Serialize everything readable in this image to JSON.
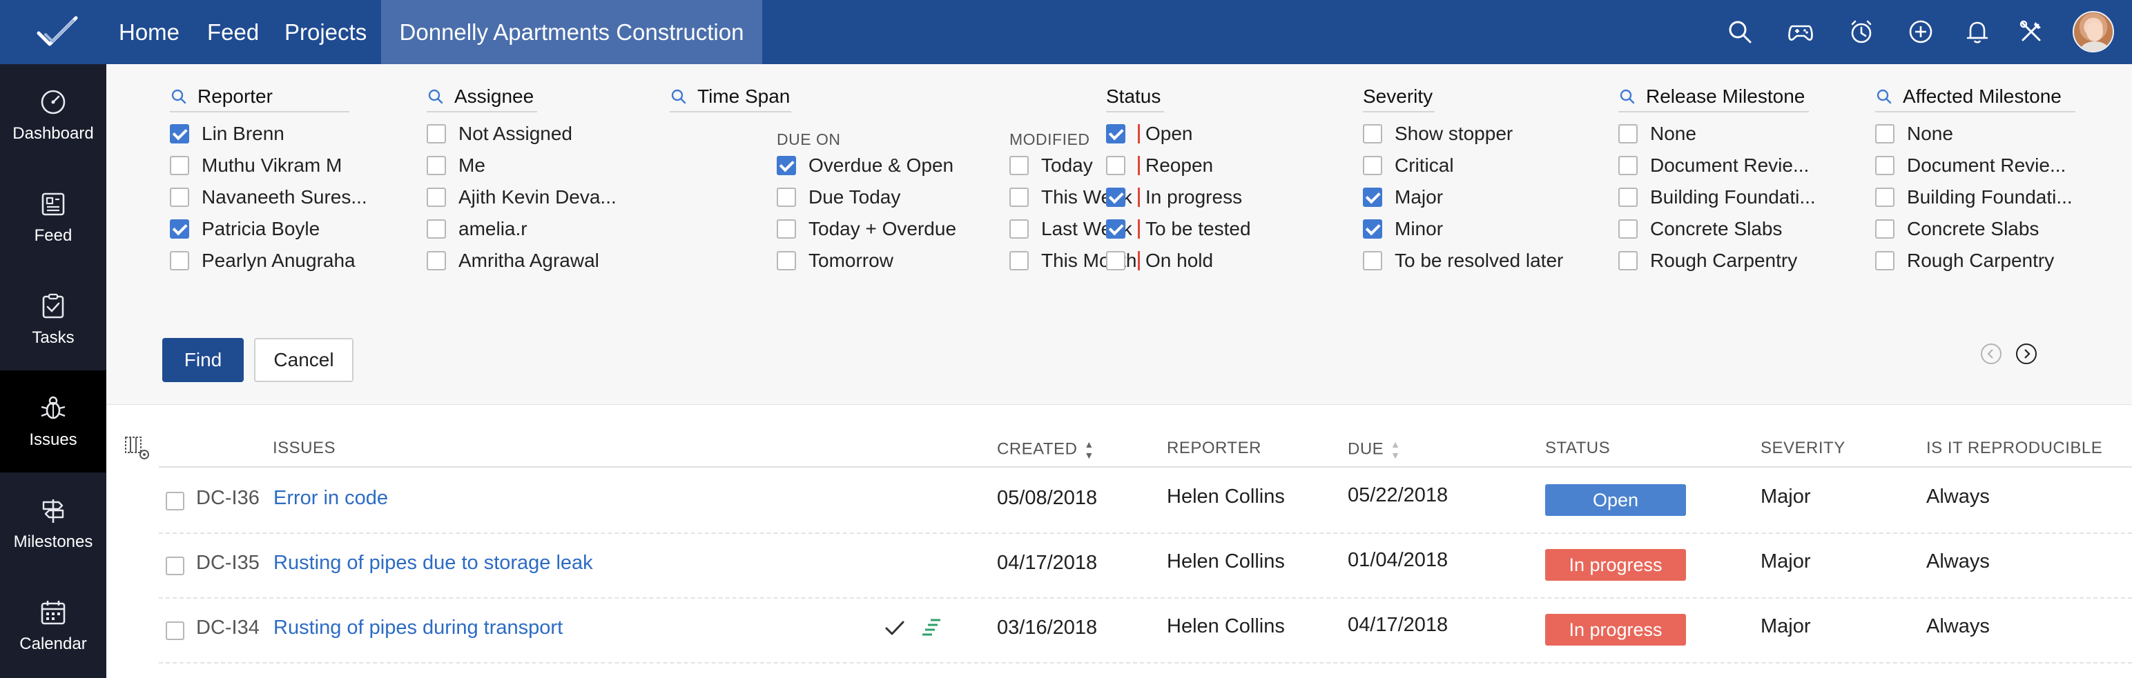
{
  "topbar": {
    "nav": [
      "Home",
      "Feed",
      "Projects"
    ],
    "project_tab": "Donnelly Apartments Construction",
    "icons": [
      "search-icon",
      "gamepad-icon",
      "timer-icon",
      "plus-circle-icon",
      "bell-icon",
      "tools-icon"
    ],
    "brand_color": "#1f4b91",
    "active_tab_color": "#4a6eab"
  },
  "sidebar": {
    "items": [
      {
        "label": "Dashboard",
        "icon": "dashboard-icon"
      },
      {
        "label": "Feed",
        "icon": "feed-icon"
      },
      {
        "label": "Tasks",
        "icon": "tasks-icon"
      },
      {
        "label": "Issues",
        "icon": "bug-icon",
        "active": true
      },
      {
        "label": "Milestones",
        "icon": "signpost-icon"
      },
      {
        "label": "Calendar",
        "icon": "calendar-icon"
      }
    ]
  },
  "filters": {
    "reporter": {
      "title": "Reporter",
      "options": [
        {
          "label": "Lin Brenn",
          "checked": true
        },
        {
          "label": "Muthu Vikram M",
          "checked": false
        },
        {
          "label": "Navaneeth Sures...",
          "checked": false
        },
        {
          "label": "Patricia Boyle",
          "checked": true
        },
        {
          "label": "Pearlyn Anugraha",
          "checked": false
        }
      ]
    },
    "assignee": {
      "title": "Assignee",
      "options": [
        {
          "label": "Not Assigned",
          "checked": false
        },
        {
          "label": "Me",
          "checked": false
        },
        {
          "label": "Ajith Kevin Deva...",
          "checked": false
        },
        {
          "label": "amelia.r",
          "checked": false
        },
        {
          "label": "Amritha Agrawal",
          "checked": false
        }
      ]
    },
    "timespan": {
      "title": "Time Span",
      "due_on": {
        "label": "DUE ON",
        "options": [
          {
            "label": "Overdue & Open",
            "checked": true
          },
          {
            "label": "Due Today",
            "checked": false
          },
          {
            "label": "Today + Overdue",
            "checked": false
          },
          {
            "label": "Tomorrow",
            "checked": false
          }
        ]
      },
      "modified": {
        "label": "MODIFIED",
        "options": [
          {
            "label": "Today",
            "checked": false
          },
          {
            "label": "This Week",
            "checked": false
          },
          {
            "label": "Last Week",
            "checked": false
          },
          {
            "label": "This Month",
            "checked": false
          }
        ]
      }
    },
    "status": {
      "title": "Status",
      "options": [
        {
          "label": "Open",
          "checked": true
        },
        {
          "label": "Reopen",
          "checked": false
        },
        {
          "label": "In progress",
          "checked": true
        },
        {
          "label": "To be tested",
          "checked": true
        },
        {
          "label": "On hold",
          "checked": false
        }
      ]
    },
    "severity": {
      "title": "Severity",
      "options": [
        {
          "label": "Show stopper",
          "checked": false
        },
        {
          "label": "Critical",
          "checked": false
        },
        {
          "label": "Major",
          "checked": true
        },
        {
          "label": "Minor",
          "checked": true
        },
        {
          "label": "To be resolved later",
          "checked": false
        }
      ]
    },
    "release_milestone": {
      "title": "Release Milestone",
      "options": [
        {
          "label": "None",
          "checked": false
        },
        {
          "label": "Document Revie...",
          "checked": false
        },
        {
          "label": "Building Foundati...",
          "checked": false
        },
        {
          "label": "Concrete Slabs",
          "checked": false
        },
        {
          "label": "Rough Carpentry",
          "checked": false
        }
      ]
    },
    "affected_milestone": {
      "title": "Affected Milestone",
      "options": [
        {
          "label": "None",
          "checked": false
        },
        {
          "label": "Document Revie...",
          "checked": false
        },
        {
          "label": "Building Foundati...",
          "checked": false
        },
        {
          "label": "Concrete Slabs",
          "checked": false
        },
        {
          "label": "Rough Carpentry",
          "checked": false
        }
      ]
    },
    "find_label": "Find",
    "cancel_label": "Cancel"
  },
  "table": {
    "columns": [
      "ISSUES",
      "CREATED",
      "REPORTER",
      "DUE",
      "STATUS",
      "SEVERITY",
      "IS IT REPRODUCIBLE"
    ],
    "rows": [
      {
        "id": "DC-I36",
        "title": "Error in code",
        "created": "05/08/2018",
        "reporter": "Helen Collins",
        "due": "05/22/2018",
        "status": "Open",
        "status_color": "#4a82cf",
        "severity": "Major",
        "reproducible": "Always",
        "icons": []
      },
      {
        "id": "DC-I35",
        "title": "Rusting of pipes due to storage leak",
        "created": "04/17/2018",
        "reporter": "Helen Collins",
        "due": "01/04/2018",
        "status": "In progress",
        "status_color": "#e8675a",
        "severity": "Major",
        "reproducible": "Always",
        "icons": []
      },
      {
        "id": "DC-I34",
        "title": "Rusting of pipes during transport",
        "created": "03/16/2018",
        "reporter": "Helen Collins",
        "due": "04/17/2018",
        "status": "In progress",
        "status_color": "#e8675a",
        "severity": "Major",
        "reproducible": "Always",
        "icons": [
          "check-icon",
          "subtasks-icon"
        ]
      }
    ]
  }
}
